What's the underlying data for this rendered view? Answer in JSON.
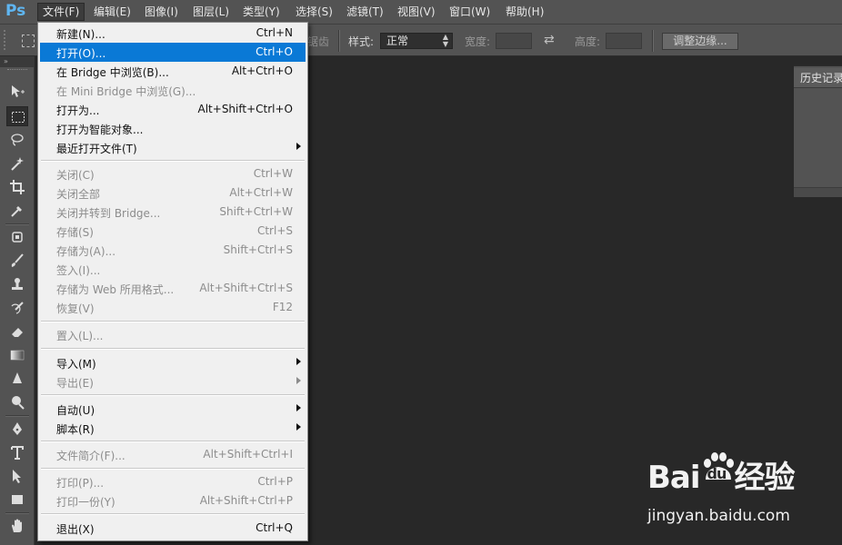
{
  "app": {
    "logo": "Ps"
  },
  "menubar": {
    "items": [
      {
        "label": "文件(F)"
      },
      {
        "label": "编辑(E)"
      },
      {
        "label": "图像(I)"
      },
      {
        "label": "图层(L)"
      },
      {
        "label": "类型(Y)"
      },
      {
        "label": "选择(S)"
      },
      {
        "label": "滤镜(T)"
      },
      {
        "label": "视图(V)"
      },
      {
        "label": "窗口(W)"
      },
      {
        "label": "帮助(H)"
      }
    ]
  },
  "options": {
    "antialias_partial": "锯齿",
    "style_label": "样式:",
    "style_value": "正常",
    "width_label": "宽度:",
    "height_label": "高度:",
    "refine_edge_button": "调整边缘..."
  },
  "panel": {
    "history_tab": "历史记录"
  },
  "file_menu": {
    "items": [
      {
        "label": "新建(N)...",
        "shortcut": "Ctrl+N"
      },
      {
        "label": "打开(O)...",
        "shortcut": "Ctrl+O"
      },
      {
        "label": "在 Bridge 中浏览(B)...",
        "shortcut": "Alt+Ctrl+O"
      },
      {
        "label": "在 Mini Bridge 中浏览(G)...",
        "shortcut": ""
      },
      {
        "label": "打开为...",
        "shortcut": "Alt+Shift+Ctrl+O"
      },
      {
        "label": "打开为智能对象...",
        "shortcut": ""
      },
      {
        "label": "最近打开文件(T)",
        "shortcut": ""
      },
      {
        "label": "关闭(C)",
        "shortcut": "Ctrl+W"
      },
      {
        "label": "关闭全部",
        "shortcut": "Alt+Ctrl+W"
      },
      {
        "label": "关闭并转到 Bridge...",
        "shortcut": "Shift+Ctrl+W"
      },
      {
        "label": "存储(S)",
        "shortcut": "Ctrl+S"
      },
      {
        "label": "存储为(A)...",
        "shortcut": "Shift+Ctrl+S"
      },
      {
        "label": "签入(I)...",
        "shortcut": ""
      },
      {
        "label": "存储为 Web 所用格式...",
        "shortcut": "Alt+Shift+Ctrl+S"
      },
      {
        "label": "恢复(V)",
        "shortcut": "F12"
      },
      {
        "label": "置入(L)...",
        "shortcut": ""
      },
      {
        "label": "导入(M)",
        "shortcut": ""
      },
      {
        "label": "导出(E)",
        "shortcut": ""
      },
      {
        "label": "自动(U)",
        "shortcut": ""
      },
      {
        "label": "脚本(R)",
        "shortcut": ""
      },
      {
        "label": "文件简介(F)...",
        "shortcut": "Alt+Shift+Ctrl+I"
      },
      {
        "label": "打印(P)...",
        "shortcut": "Ctrl+P"
      },
      {
        "label": "打印一份(Y)",
        "shortcut": "Alt+Shift+Ctrl+P"
      },
      {
        "label": "退出(X)",
        "shortcut": "Ctrl+Q"
      }
    ]
  },
  "watermark": {
    "brand_left": "Bai",
    "brand_mid": "du",
    "brand_right": "经验",
    "url": "jingyan.baidu.com"
  },
  "colors": {
    "menu_highlight": "#0a79d6",
    "ps_logo": "#5fb6f2",
    "chrome": "#535353",
    "canvas": "#282828"
  },
  "tools": [
    "move-tool",
    "marquee-tool",
    "lasso-tool",
    "magic-wand-tool",
    "crop-tool",
    "eyedropper-tool",
    "spot-healing-tool",
    "brush-tool",
    "clone-stamp-tool",
    "history-brush-tool",
    "eraser-tool",
    "gradient-tool",
    "blur-tool",
    "dodge-tool",
    "pen-tool",
    "type-tool",
    "path-selection-tool",
    "rectangle-tool",
    "hand-tool"
  ]
}
